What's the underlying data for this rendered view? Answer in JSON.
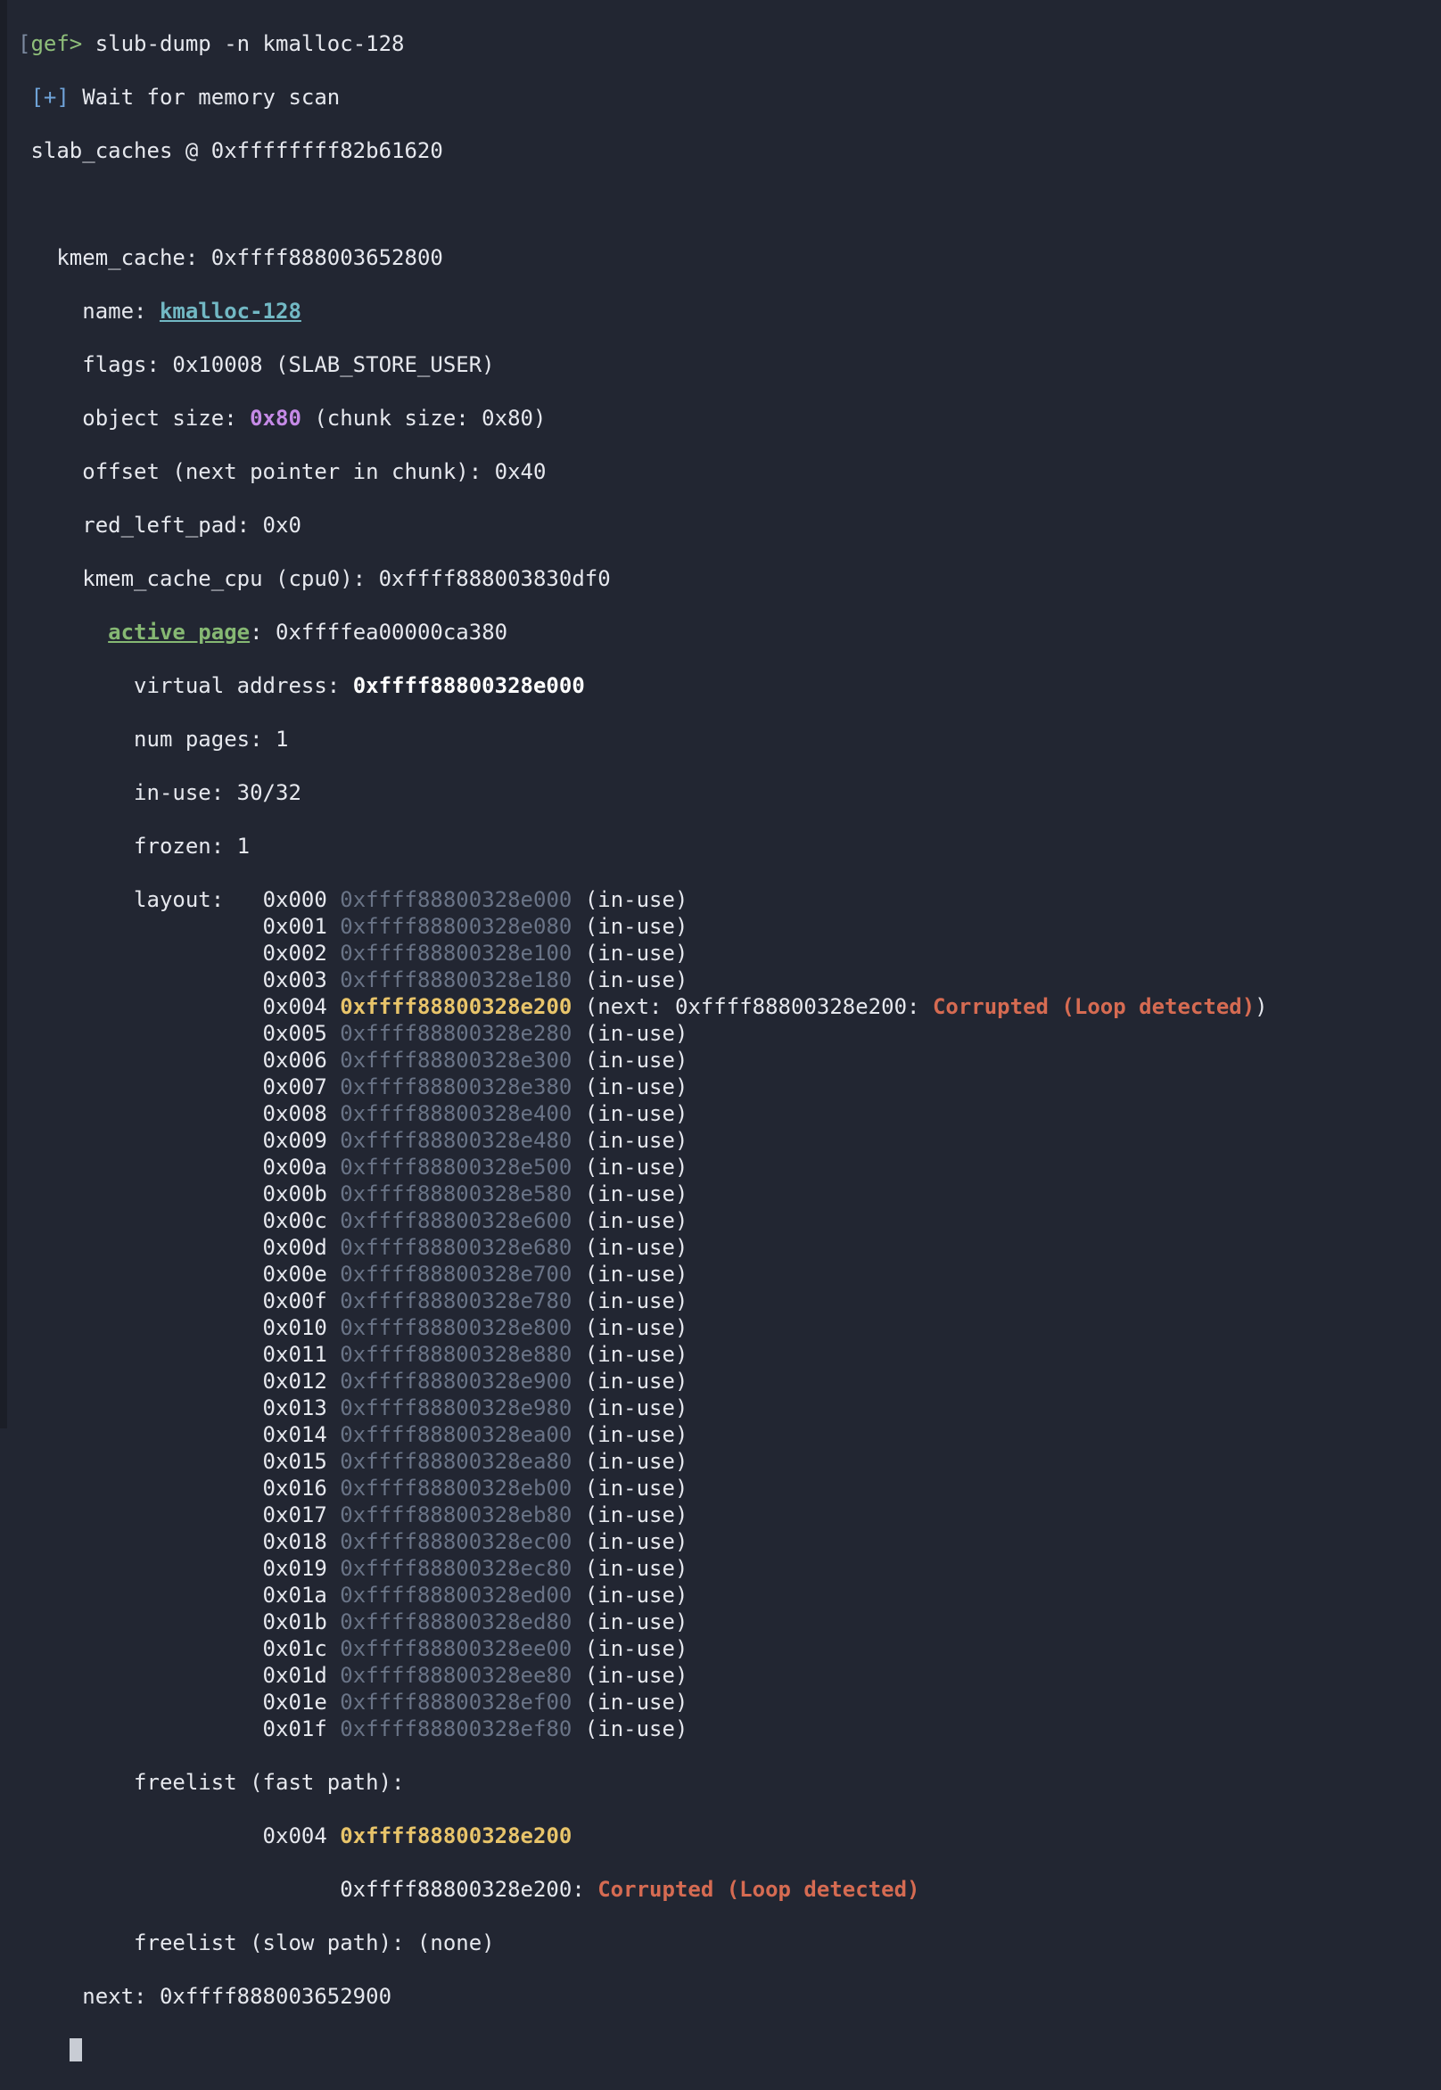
{
  "prompt": {
    "open_bracket": "[",
    "label": "gef>",
    "command": "slub-dump -n kmalloc-128"
  },
  "header": {
    "info_tag": "[+]",
    "wait_msg": "Wait for memory scan",
    "slab_caches": "slab_caches @ 0xffffffff82b61620"
  },
  "cache": {
    "kmem_cache_label": "kmem_cache:",
    "kmem_cache_addr": "0xffff888003652800",
    "name_label": "name:",
    "name": "kmalloc-128",
    "flags": "flags: 0x10008 (SLAB_STORE_USER)",
    "object_size_label": "object size:",
    "object_size": "0x80",
    "chunk_size": "(chunk size: 0x80)",
    "offset": "offset (next pointer in chunk): 0x40",
    "red_left_pad": "red_left_pad: 0x0",
    "cpu": "kmem_cache_cpu (cpu0): 0xffff888003830df0"
  },
  "active_page": {
    "label": "active page",
    "addr": ": 0xffffea00000ca380",
    "vaddr_label": "virtual address:",
    "vaddr": "0xffff88800328e000",
    "num_pages": "num pages: 1",
    "in_use": "in-use: 30/32",
    "frozen": "frozen: 1",
    "layout_label": "layout:"
  },
  "layout": [
    {
      "idx": "0x000",
      "addr": "0xffff88800328e000",
      "status": "(in-use)"
    },
    {
      "idx": "0x001",
      "addr": "0xffff88800328e080",
      "status": "(in-use)"
    },
    {
      "idx": "0x002",
      "addr": "0xffff88800328e100",
      "status": "(in-use)"
    },
    {
      "idx": "0x003",
      "addr": "0xffff88800328e180",
      "status": "(in-use)"
    },
    {
      "idx": "0x004",
      "addr": "0xffff88800328e200",
      "next_prefix": "(next: 0xffff88800328e200: ",
      "error": "Corrupted (Loop detected)",
      "next_suffix": ")"
    },
    {
      "idx": "0x005",
      "addr": "0xffff88800328e280",
      "status": "(in-use)"
    },
    {
      "idx": "0x006",
      "addr": "0xffff88800328e300",
      "status": "(in-use)"
    },
    {
      "idx": "0x007",
      "addr": "0xffff88800328e380",
      "status": "(in-use)"
    },
    {
      "idx": "0x008",
      "addr": "0xffff88800328e400",
      "status": "(in-use)"
    },
    {
      "idx": "0x009",
      "addr": "0xffff88800328e480",
      "status": "(in-use)"
    },
    {
      "idx": "0x00a",
      "addr": "0xffff88800328e500",
      "status": "(in-use)"
    },
    {
      "idx": "0x00b",
      "addr": "0xffff88800328e580",
      "status": "(in-use)"
    },
    {
      "idx": "0x00c",
      "addr": "0xffff88800328e600",
      "status": "(in-use)"
    },
    {
      "idx": "0x00d",
      "addr": "0xffff88800328e680",
      "status": "(in-use)"
    },
    {
      "idx": "0x00e",
      "addr": "0xffff88800328e700",
      "status": "(in-use)"
    },
    {
      "idx": "0x00f",
      "addr": "0xffff88800328e780",
      "status": "(in-use)"
    },
    {
      "idx": "0x010",
      "addr": "0xffff88800328e800",
      "status": "(in-use)"
    },
    {
      "idx": "0x011",
      "addr": "0xffff88800328e880",
      "status": "(in-use)"
    },
    {
      "idx": "0x012",
      "addr": "0xffff88800328e900",
      "status": "(in-use)"
    },
    {
      "idx": "0x013",
      "addr": "0xffff88800328e980",
      "status": "(in-use)"
    },
    {
      "idx": "0x014",
      "addr": "0xffff88800328ea00",
      "status": "(in-use)"
    },
    {
      "idx": "0x015",
      "addr": "0xffff88800328ea80",
      "status": "(in-use)"
    },
    {
      "idx": "0x016",
      "addr": "0xffff88800328eb00",
      "status": "(in-use)"
    },
    {
      "idx": "0x017",
      "addr": "0xffff88800328eb80",
      "status": "(in-use)"
    },
    {
      "idx": "0x018",
      "addr": "0xffff88800328ec00",
      "status": "(in-use)"
    },
    {
      "idx": "0x019",
      "addr": "0xffff88800328ec80",
      "status": "(in-use)"
    },
    {
      "idx": "0x01a",
      "addr": "0xffff88800328ed00",
      "status": "(in-use)"
    },
    {
      "idx": "0x01b",
      "addr": "0xffff88800328ed80",
      "status": "(in-use)"
    },
    {
      "idx": "0x01c",
      "addr": "0xffff88800328ee00",
      "status": "(in-use)"
    },
    {
      "idx": "0x01d",
      "addr": "0xffff88800328ee80",
      "status": "(in-use)"
    },
    {
      "idx": "0x01e",
      "addr": "0xffff88800328ef00",
      "status": "(in-use)"
    },
    {
      "idx": "0x01f",
      "addr": "0xffff88800328ef80",
      "status": "(in-use)"
    }
  ],
  "freelist": {
    "fast_label": "freelist (fast path):",
    "fast_idx": "0x004",
    "fast_addr": "0xffff88800328e200",
    "fast_next": "0xffff88800328e200:",
    "fast_error": "Corrupted (Loop detected)",
    "slow": "freelist (slow path): (none)",
    "next": "next: 0xffff888003652900"
  },
  "colors": {
    "background": "#222632",
    "prompt": "#8fbf7a",
    "dim_addr": "#6a7487",
    "highlight_addr": "#e8c46a",
    "error": "#d66b52",
    "magenta": "#c58ae6",
    "link_cyan": "#72b8c4",
    "link_green": "#86b873"
  }
}
